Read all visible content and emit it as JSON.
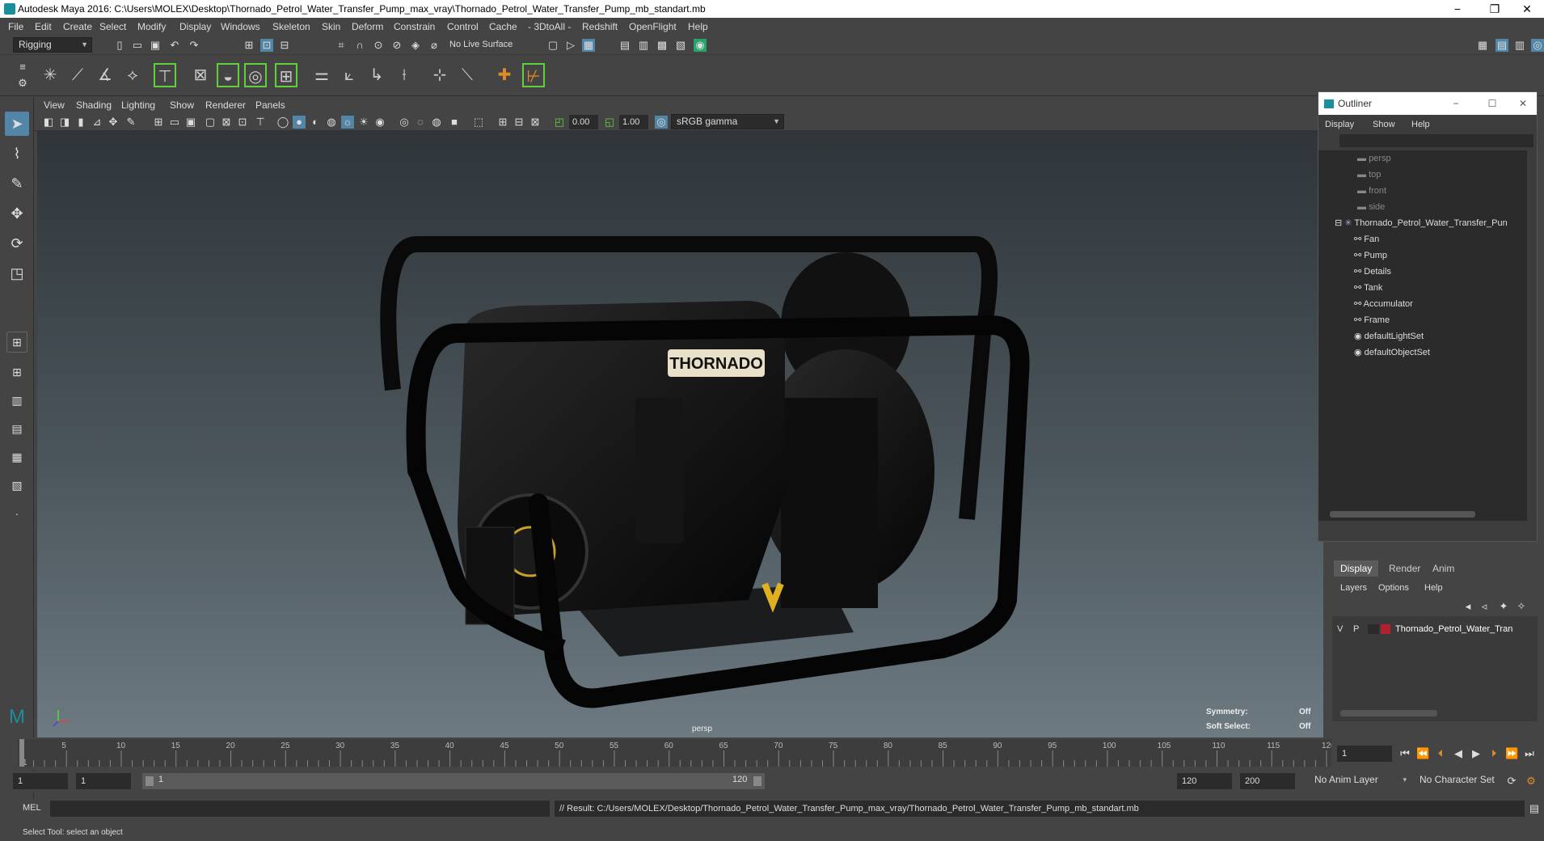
{
  "window": {
    "title": "Autodesk Maya 2016: C:\\Users\\MOLEX\\Desktop\\Thornado_Petrol_Water_Transfer_Pump_max_vray\\Thornado_Petrol_Water_Transfer_Pump_mb_standart.mb",
    "minimize": "−",
    "restore": "❐",
    "close": "✕"
  },
  "menubar": [
    "File",
    "Edit",
    "Create",
    "Select",
    "Modify",
    "Display",
    "Windows",
    "Skeleton",
    "Skin",
    "Deform",
    "Constrain",
    "Control",
    "Cache",
    "- 3DtoAll -",
    "Redshift",
    "OpenFlight",
    "Help"
  ],
  "statusline": {
    "mode": "Rigging",
    "live_surface": "No Live Surface"
  },
  "panel_menu": [
    "View",
    "Shading",
    "Lighting",
    "Show",
    "Renderer",
    "Panels"
  ],
  "panel_toolbar": {
    "exposure": "0.00",
    "gamma": "1.00",
    "color_space": "sRGB gamma"
  },
  "viewport": {
    "camera": "persp",
    "symmetry_label": "Symmetry:",
    "symmetry_value": "Off",
    "soft_select_label": "Soft Select:",
    "soft_select_value": "Off",
    "brand_text": "THORNADO"
  },
  "outliner": {
    "title": "Outliner",
    "menu": [
      "Display",
      "Show",
      "Help"
    ],
    "cameras": [
      "persp",
      "top",
      "front",
      "side"
    ],
    "root": "Thornado_Petrol_Water_Transfer_Pun",
    "children": [
      "Fan",
      "Pump",
      "Details",
      "Tank",
      "Accumulator",
      "Frame"
    ],
    "sets": [
      "defaultLightSet",
      "defaultObjectSet"
    ]
  },
  "layer_editor": {
    "tabs": [
      "Display",
      "Render",
      "Anim"
    ],
    "menu": [
      "Layers",
      "Options",
      "Help"
    ],
    "layer": {
      "v": "V",
      "p": "P",
      "name": "Thornado_Petrol_Water_Tran",
      "color": "#b0232e"
    }
  },
  "timeline": {
    "ticks": [
      "1",
      "5",
      "10",
      "15",
      "20",
      "25",
      "30",
      "35",
      "40",
      "45",
      "50",
      "55",
      "60",
      "65",
      "70",
      "75",
      "80",
      "85",
      "90",
      "95",
      "100",
      "105",
      "110",
      "115",
      "120"
    ],
    "current_frame": "1"
  },
  "range": {
    "start": "1",
    "playback_start": "1",
    "slider_start": "1",
    "slider_end": "120",
    "playback_end": "120",
    "end": "200",
    "anim_layer": "No Anim Layer",
    "character_set": "No Character Set"
  },
  "command": {
    "language": "MEL",
    "result": "// Result: C:/Users/MOLEX/Desktop/Thornado_Petrol_Water_Transfer_Pump_max_vray/Thornado_Petrol_Water_Transfer_Pump_mb_standart.mb"
  },
  "help_line": "Select Tool: select an object",
  "colors": {
    "accent_teal": "#1a8f9c",
    "active_blue": "#5285a6",
    "green": "#5fcf3a"
  }
}
